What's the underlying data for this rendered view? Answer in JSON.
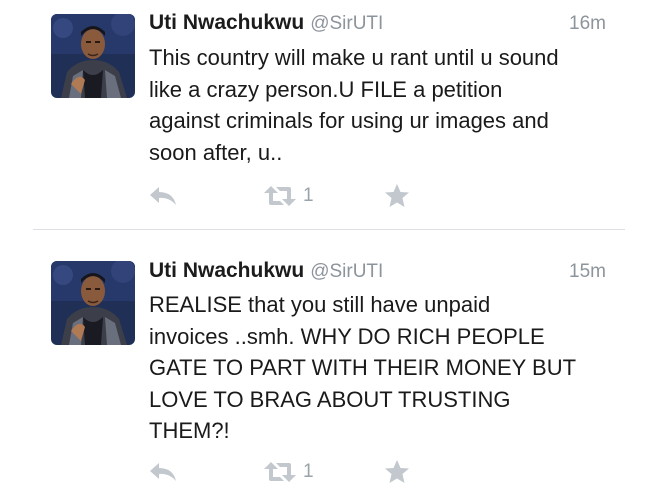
{
  "tweets": [
    {
      "display_name": "Uti Nwachukwu",
      "handle": "@SirUTI",
      "time": "16m",
      "text": "This country will make u rant until u sound\nlike a crazy person.U FILE  a petition\nagainst criminals for using ur images and\nsoon after, u..",
      "retweet_count": "1",
      "icons": {
        "reply": "reply-icon",
        "retweet": "retweet-icon",
        "favorite": "star-icon"
      }
    },
    {
      "display_name": "Uti Nwachukwu",
      "handle": "@SirUTI",
      "time": "15m",
      "text": "REALISE that you still have unpaid\ninvoices ..smh. WHY DO RICH PEOPLE\nGATE TO PART WITH THEIR MONEY BUT\nLOVE TO BRAG ABOUT TRUSTING\nTHEM?!",
      "retweet_count": "1",
      "icons": {
        "reply": "reply-icon",
        "retweet": "retweet-icon",
        "favorite": "star-icon"
      }
    }
  ],
  "colors": {
    "name": "#1c1c1c",
    "meta": "#8d959c",
    "action_icon": "#c2c8cd",
    "divider": "#dde1e5"
  }
}
